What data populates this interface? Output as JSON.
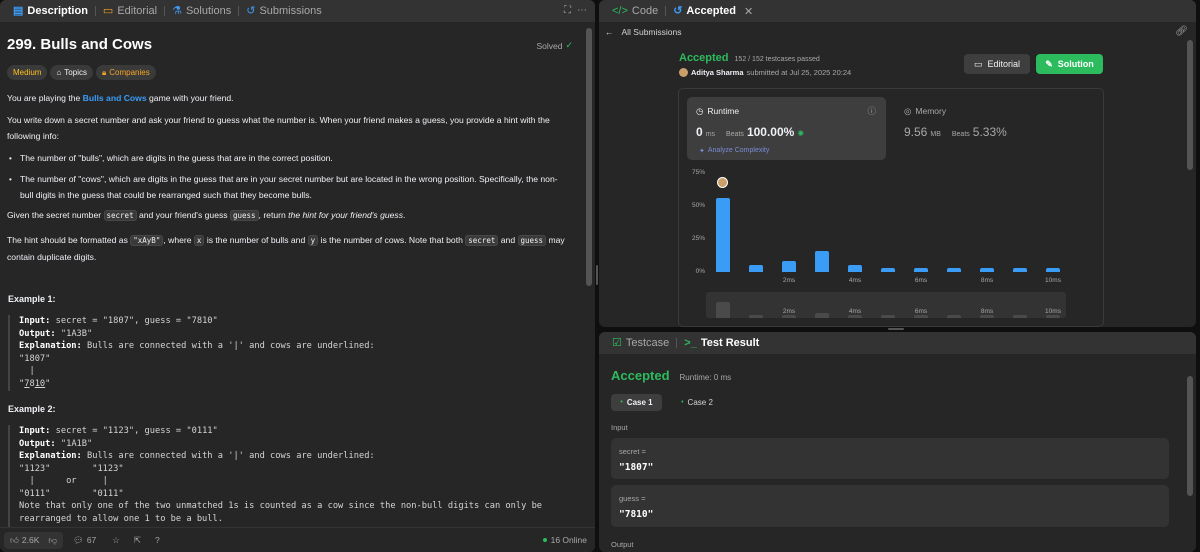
{
  "left_tabs": [
    {
      "label": "Description"
    },
    {
      "label": "Editorial"
    },
    {
      "label": "Solutions"
    },
    {
      "label": "Submissions"
    }
  ],
  "problem": {
    "title": "299. Bulls and Cows",
    "status": "Solved",
    "difficulty": "Medium",
    "topics_label": "Topics",
    "companies_label": "Companies"
  },
  "description": {
    "p1_pre": "You are playing the ",
    "p1_link": "Bulls and Cows",
    "p1_post": " game with your friend.",
    "p2": "You write down a secret number and ask your friend to guess what the number is. When your friend makes a guess, you provide a hint with the following info:",
    "bullet1": "The number of \"bulls\", which are digits in the guess that are in the correct position.",
    "bullet2": "The number of \"cows\", which are digits in the guess that are in your secret number but are located in the wrong position. Specifically, the non-bull digits in the guess that could be rearranged such that they become bulls.",
    "p3_a": "Given the secret number ",
    "p3_code1": "secret",
    "p3_b": " and your friend's guess ",
    "p3_code2": "guess",
    "p3_c": ", return ",
    "p3_em": "the hint for your friend's guess",
    "p3_d": ".",
    "p4_a": "The hint should be formatted as ",
    "p4_code1": "\"xAyB\"",
    "p4_b": ", where ",
    "p4_code2": "x",
    "p4_c": " is the number of bulls and ",
    "p4_code3": "y",
    "p4_d": " is the number of cows. Note that both ",
    "p4_code4": "secret",
    "p4_e": " and ",
    "p4_code5": "guess",
    "p4_f": " may contain duplicate digits."
  },
  "example1": {
    "heading": "Example 1:",
    "input_label": "Input:",
    "input": " secret = \"1807\", guess = \"7810\"",
    "output_label": "Output:",
    "output": " \"1A3B\"",
    "expl_label": "Explanation:",
    "expl": " Bulls are connected with a '|' and cows are underlined:",
    "l1": "\"1807\"",
    "l2": "  |",
    "l3a": "\"",
    "l3b": "7",
    "l3c": "8",
    "l3d": "10",
    "l3e": "\""
  },
  "example2": {
    "heading": "Example 2:",
    "input_label": "Input:",
    "input": " secret = \"1123\", guess = \"0111\"",
    "output_label": "Output:",
    "output": " \"1A1B\"",
    "expl_label": "Explanation:",
    "expl": " Bulls are connected with a '|' and cows are underlined:",
    "l1": "\"1123\"        \"1123\"",
    "l2": "  |      or     |",
    "l3": "\"0111\"        \"0111\"",
    "note1": "Note that only one of the two unmatched 1s is counted as a cow since the non-bull digits can only be",
    "note2": "rearranged to allow one 1 to be a bull."
  },
  "footer": {
    "likes": "2.6K",
    "comments": "67",
    "online": "16 Online"
  },
  "right_tabs": [
    {
      "label": "Code"
    },
    {
      "label": "Accepted"
    }
  ],
  "submission": {
    "back_label": "All Submissions",
    "status": "Accepted",
    "passed": "152 / 152 testcases passed",
    "user": "Aditya Sharma",
    "submitted": "submitted at Jul 25, 2025 20:24",
    "editorial_btn": "Editorial",
    "solution_btn": "Solution"
  },
  "runtime": {
    "label": "Runtime",
    "value": "0",
    "unit": "ms",
    "beats_label": "Beats",
    "beats": "100.00%",
    "analyze": "Analyze Complexity"
  },
  "memory": {
    "label": "Memory",
    "value": "9.56",
    "unit": "MB",
    "beats_label": "Beats",
    "beats": "5.33%"
  },
  "chart_data": {
    "type": "bar",
    "yticks": [
      "75%",
      "50%",
      "25%",
      "0%"
    ],
    "ylim": [
      0,
      75
    ],
    "xticks": [
      "2ms",
      "4ms",
      "6ms",
      "8ms",
      "10ms"
    ],
    "values": [
      56,
      5,
      8,
      16,
      5,
      3,
      3,
      3,
      3,
      3,
      3
    ],
    "highlight_index": 0
  },
  "colors": {
    "accent_green": "#2cbb5d",
    "accent_blue": "#3b9cf6",
    "medium_yellow": "#ffc01e",
    "panel": "#262626"
  },
  "bottom_tabs": [
    {
      "label": "Testcase"
    },
    {
      "label": "Test Result"
    }
  ],
  "result": {
    "status": "Accepted",
    "runtime": "Runtime: 0 ms",
    "case1": "Case 1",
    "case2": "Case 2",
    "input_label": "Input",
    "secret_label": "secret =",
    "secret_value": "\"1807\"",
    "guess_label": "guess =",
    "guess_value": "\"7810\"",
    "output_label": "Output"
  }
}
